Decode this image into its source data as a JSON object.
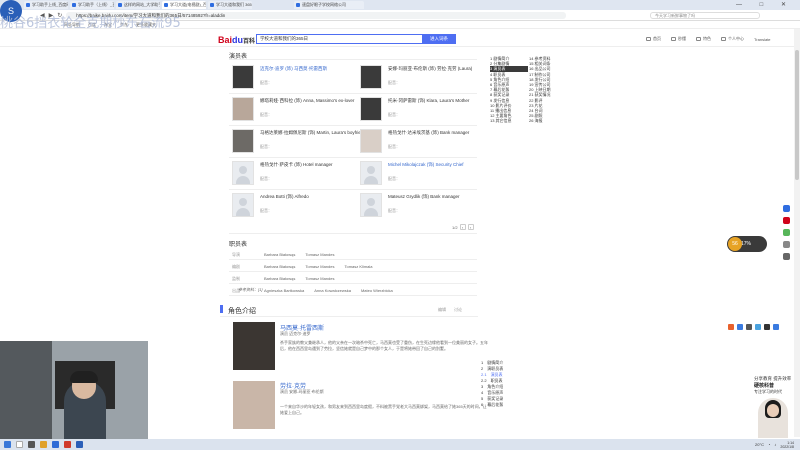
{
  "browser": {
    "tabs": [
      "学习助手上线_百度网",
      "学习助手（上线）_百度",
      "这样的网站_大学助手_百度",
      "学习大道(电视剧)_百度百科",
      "学习大道和我们 3651..."
    ],
    "active_tab_index": 3,
    "popup_tab": "速盘好眼子学校网络公司",
    "window_controls": "— □ ✕",
    "url": "https://baike.baidu.com/item/学习大道和我们的365日/57148592?fr=aladdin",
    "right_search_placeholder": "今天学习新鲜事物了吗",
    "bookmarks": [
      "网址导航",
      "百度",
      "淘宝",
      "京东",
      "更多收藏夹"
    ],
    "overlay_text": "桃谷6挡衣轮全克期杪东石流95",
    "logo_glyph": "S"
  },
  "page": {
    "logo_red": "Bai",
    "logo_blue": "du",
    "logo_suffix": "百科",
    "search_value": "学校大道和我们的365日",
    "search_button": "进入词条",
    "top_links": [
      "首页",
      "秒懂",
      "特色",
      "个人中心",
      "Translate"
    ]
  },
  "cast": {
    "title": "演员表",
    "items": [
      {
        "name": "迈克尔·迪罗 (饰) 马西莫·托雷西斯",
        "dub": "配音：",
        "photo": "dark"
      },
      {
        "name": "安娜-玛丽亚·布伦斯 (饰) 劳拉·克劳 (Laura)",
        "dub": "配音：",
        "photo": "dark"
      },
      {
        "name": "娜塔莉娅·西科拉 (饰) Anna, Massimo's ex-lover",
        "dub": "配音：",
        "photo": "light"
      },
      {
        "name": "托米·冈萨雷斯 (饰) Klara, Laura's Mother",
        "dub": "配音：",
        "photo": "dark"
      },
      {
        "name": "马格达莱娜·拉姆佩尼斯 (饰) Martin, Laura's boyfriend",
        "dub": "配音：",
        "photo": "mid"
      },
      {
        "name": "格热戈什·达米埃茨基 (饰) Bank manager",
        "dub": "配音：",
        "photo": "pale"
      },
      {
        "name": "格热戈什·萨皮卡 (饰) Hotel manager",
        "dub": "配音：",
        "photo": "ph"
      },
      {
        "name": "Michel Mikolajczak (饰) Security Chief",
        "dub": "配音：",
        "photo": "ph"
      },
      {
        "name": "Andrea Botti (饰) Alfredo",
        "dub": "配音：",
        "photo": "ph"
      },
      {
        "name": "Mateusz Grydlik (饰) Bank manager",
        "dub": "配音：",
        "photo": "ph"
      }
    ],
    "pager": "1/2"
  },
  "staff": {
    "title": "职员表",
    "rows": [
      {
        "label": "导演",
        "names": [
          "Barbara Białowąs",
          "Tomasz Mandes"
        ]
      },
      {
        "label": "编剧",
        "names": [
          "Barbara Białowąs",
          "Tomasz Mandes",
          "Tomasz Klimala"
        ]
      },
      {
        "label": "监制",
        "names": [
          "Barbara Białowąs",
          "Tomasz Mandes"
        ]
      },
      {
        "label": "出品",
        "names": [
          "Agnieszka Bartkowska",
          "Anna Kowalczewska",
          "Mateo Wierzbicka"
        ]
      }
    ],
    "note": "参考资料：[1]"
  },
  "roles": {
    "title": "角色介绍",
    "actions": [
      "编辑",
      "讨论"
    ],
    "items": [
      {
        "name": "马西莫·托雷西斯",
        "actor": "演员 迈克尔·迪罗",
        "text": "杀手家族的教父兼继承人，他的父亲在一次暗杀中死亡，马西莫也受了重伤，在生死边缘他看到一位美丽的女子。五年后，他在西西里岛遇到了劳拉，坚信她就是自己梦中的那个女人，于是将她带回了自己的别墅。"
      },
      {
        "name": "劳拉·克劳",
        "actor": "演员 安娜-玛丽亚·布伦斯",
        "text": "一个来自华沙的年轻女孩，和男友来到西西里岛度假，不料被黑手党老大马西莫绑架，马西莫给了她365天的时间，让她爱上自己。"
      }
    ]
  },
  "toc": {
    "col1": [
      "1 剧情简介",
      "2 分集剧情",
      "3 演员表",
      "4 职员表",
      "5 角色介绍",
      "6 音乐原声",
      "7 幕后花絮",
      "8 获奖记录",
      "9 发行信息",
      "10 影片评价",
      "11 播出信息",
      "12 主要角色",
      "13 其它信息"
    ],
    "col2": [
      "14 参考资料",
      "15 相关词条",
      "16 出品公司",
      "17 制作公司",
      "18 发行公司",
      "19 宣传公司",
      "20 上映日期",
      "21 获奖情况",
      "22 影评",
      "23 片花",
      "24 台词",
      "25 剧照",
      "26 海报"
    ],
    "selected": "3 演员表"
  },
  "sidetoc": [
    {
      "n": "1",
      "label": "剧情简介"
    },
    {
      "n": "2",
      "label": "演职员表"
    },
    {
      "n": "2.1",
      "label": "演员表"
    },
    {
      "n": "2.2",
      "label": "职员表"
    },
    {
      "n": "3",
      "label": "角色介绍"
    },
    {
      "n": "4",
      "label": "音乐原声"
    },
    {
      "n": "5",
      "label": "获奖记录"
    },
    {
      "n": "6",
      "label": "幕后花絮"
    }
  ],
  "badge": {
    "value": "56",
    "unit": "17%"
  },
  "streamer": {
    "line1": "分享教育 提升效率",
    "line2": "硬核科普",
    "line3": "专注学习的时代"
  },
  "tray": {
    "temp": "20°C",
    "time": "1:14",
    "date": "2022/1/8"
  },
  "colors": {
    "accent": "#4e6ef2",
    "link": "#3366cc",
    "baidu_red": "#d0021b"
  }
}
